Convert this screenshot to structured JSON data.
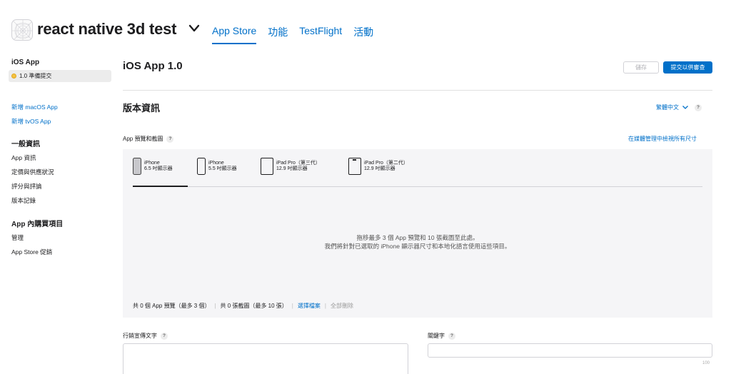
{
  "header": {
    "app_title": "react native 3d test",
    "tabs": [
      {
        "label": "App Store",
        "active": true
      },
      {
        "label": "功能",
        "active": false
      },
      {
        "label": "TestFlight",
        "active": false
      },
      {
        "label": "活動",
        "active": false
      }
    ]
  },
  "sidebar": {
    "ios_section": "iOS App",
    "version_item": "1.0 準備提交",
    "add_links": [
      "新增 macOS App",
      "新增 tvOS App"
    ],
    "general_section": "一般資訊",
    "general_items": [
      "App 資訊",
      "定價與供應狀況",
      "評分與評論",
      "版本記錄"
    ],
    "iap_section": "App 內購買項目",
    "iap_items": [
      "管理",
      "App Store 促銷"
    ]
  },
  "main": {
    "title": "iOS App 1.0",
    "save_label": "儲存",
    "submit_label": "提交以供審查",
    "section_title": "版本資訊",
    "language": "繁體中文",
    "help_glyph": "?",
    "preview_label": "App 預覽和截圖",
    "media_link": "在媒體管理中檢視所有尺寸",
    "device_tabs": [
      {
        "line1": "iPhone",
        "line2": "6.5 吋顯示器",
        "icon": "iphone-modern-icon",
        "active": true
      },
      {
        "line1": "iPhone",
        "line2": "5.5 吋顯示器",
        "icon": "iphone-classic-icon",
        "active": false
      },
      {
        "line1": "iPad Pro（第三代）",
        "line2": "12.9 吋顯示器",
        "icon": "ipad-pro-3-icon",
        "active": false
      },
      {
        "line1": "iPad Pro（第二代）",
        "line2": "12.9 吋顯示器",
        "icon": "ipad-pro-2-icon",
        "active": false
      }
    ],
    "drop_line1": "拖移最多 3 個 App 預覽和 10 張截圖至此處。",
    "drop_line2": "我們將針對已選取的 iPhone 顯示器尺寸和本地化語言使用這些項目。",
    "preview_count": "共 0 個 App 預覽（最多 3 個）",
    "screenshot_count": "共 0 張截圖（最多 10 張）",
    "choose_file": "選擇檔案",
    "delete_all": "全部刪除",
    "promo_label": "行銷宣傳文字",
    "keywords_label": "關鍵字",
    "keywords_remaining": "100"
  },
  "colors": {
    "accent": "#0070c9",
    "status_dot": "#f5c242"
  }
}
